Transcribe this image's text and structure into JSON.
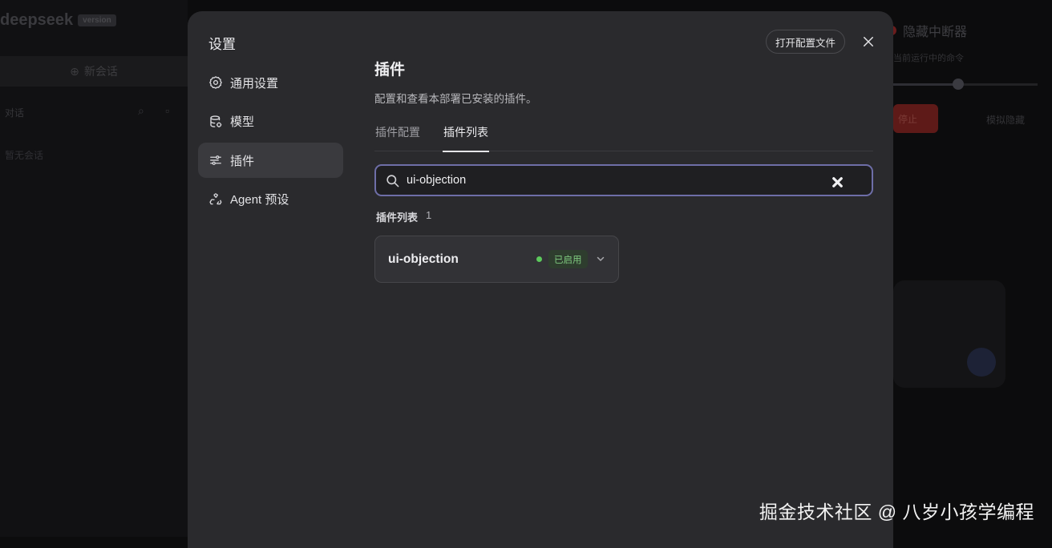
{
  "background": {
    "logo": "deepseek",
    "logo_version": "version",
    "new_chat": "新会话",
    "search_placeholder": "对话",
    "hint": "暂无会话",
    "right_title": "隐藏中断器",
    "right_sub": "当前运行中的命令",
    "red_button": "停止",
    "right_link": "模拟隐藏"
  },
  "modal": {
    "title": "设置",
    "open_config_label": "打开配置文件",
    "nav": [
      {
        "label": "通用设置",
        "icon": "gear-icon"
      },
      {
        "label": "模型",
        "icon": "database-icon"
      },
      {
        "label": "插件",
        "icon": "sliders-icon"
      },
      {
        "label": "Agent 预设",
        "icon": "recycle-icon"
      }
    ]
  },
  "content": {
    "title": "插件",
    "description": "配置和查看本部署已安装的插件。",
    "tabs": [
      {
        "label": "插件配置"
      },
      {
        "label": "插件列表"
      }
    ],
    "search": {
      "value": "ui-objection"
    },
    "list_label": "插件列表",
    "list_count": "1",
    "plugins": [
      {
        "name": "ui-objection",
        "status": "已启用"
      }
    ]
  },
  "colors": {
    "accent_border": "#6e6ea8",
    "enabled_dot": "#5cc95c",
    "enabled_badge_text": "#7fc97f"
  },
  "watermark": "掘金技术社区 @ 八岁小孩学编程"
}
